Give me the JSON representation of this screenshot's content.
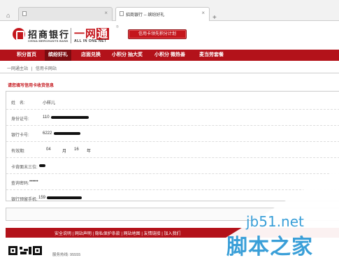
{
  "browser": {
    "tabs": [
      {
        "title": "",
        "active": false
      },
      {
        "title": "招商银行 -- 缤纷好礼",
        "active": true
      }
    ]
  },
  "header": {
    "bank_name": "招商银行",
    "bank_name_en": "CHINA MERCHANTS BANK",
    "brand_cn_dash": "一网",
    "brand_cn_box": "通",
    "brand_en": "ALL IN ONE NET",
    "reg_mark": "®",
    "plan_button": "信用卡领先积分计划"
  },
  "nav": {
    "items": [
      "积分首页",
      "缤纷好礼",
      "店面兑换",
      "小积分 抽大奖",
      "小积分 微热善",
      "麦当劳套餐"
    ],
    "active_index": 1
  },
  "breadcrumb": [
    "一网通主站",
    "|",
    "信用卡网站"
  ],
  "form": {
    "title": "请您填写信用卡收货信息",
    "rows": [
      {
        "label": "姓　名:",
        "value": "小样儿"
      },
      {
        "label": "身份证号:",
        "value": "110"
      },
      {
        "label": "银行卡号:",
        "value": "6222"
      },
      {
        "label": "有效期:",
        "month": "04",
        "month_unit": "月",
        "year": "16",
        "year_unit": "年"
      },
      {
        "label": "卡背面末三位:",
        "value": ""
      },
      {
        "label": "查询密码:",
        "value": "••••••"
      },
      {
        "label": "银行预留手机:",
        "value": "159"
      }
    ]
  },
  "footer": {
    "links": "安全说明 | 网站声明 | 隐私保护条款 | 网站地图 | 友情链接 | 加入我们",
    "hotline": "服务热线: 95555"
  },
  "watermark": {
    "en": "jb51.net",
    "cn": "脚本之家"
  },
  "colors": {
    "brand_red": "#c4161c",
    "nav_red": "#b3121a",
    "nav_active": "#7b0b10",
    "watermark_blue": "#3a9fd8"
  }
}
